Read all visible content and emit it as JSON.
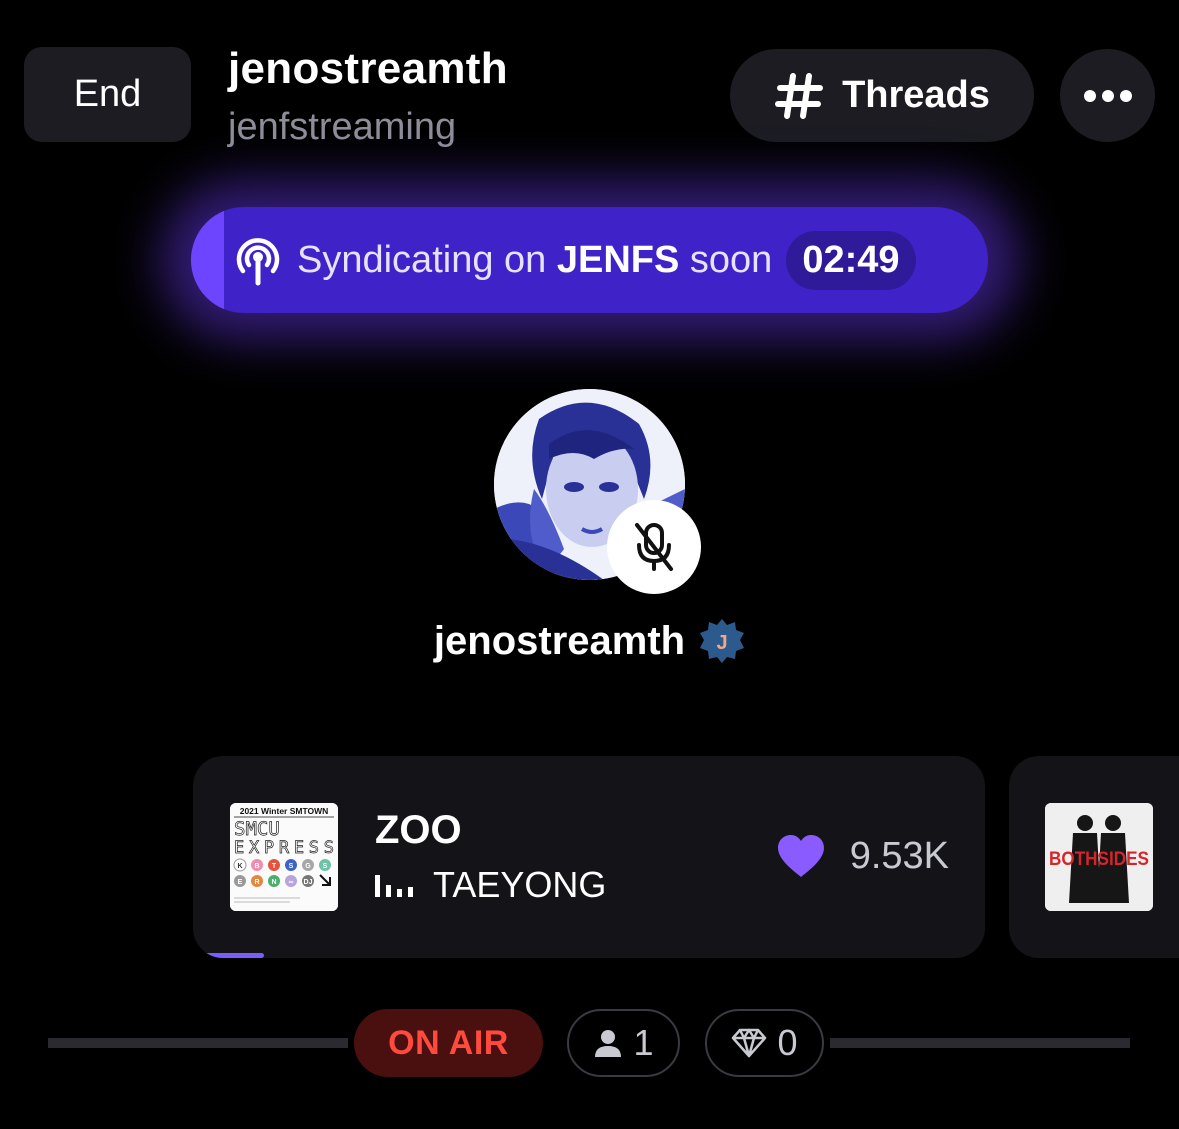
{
  "header": {
    "end_label": "End",
    "station_name": "jenostreamth",
    "station_handle": "jenfstreaming",
    "threads_label": "Threads",
    "threads_icon": "hash-icon",
    "more_icon": "more-dots-icon"
  },
  "syndication": {
    "prefix": "Syndicating on",
    "target": "JENFS",
    "suffix": "soon",
    "countdown": "02:49",
    "icon": "podcast-broadcast-icon",
    "color": "#3f22c8"
  },
  "host": {
    "name": "jenostreamth",
    "badge_letter": "J",
    "muted": true,
    "mute_icon": "mic-off-icon"
  },
  "now_playing": {
    "title": "ZOO",
    "artist": "TAEYONG",
    "likes": "9.53K",
    "heart_color": "#8a5cff",
    "progress": 0.09,
    "album_art": {
      "header": "2021 Winter SMTOWN",
      "line1": "SMCU",
      "line2": "EXPRESS",
      "row1": [
        "K",
        "B",
        "T",
        "S",
        "G",
        "S"
      ],
      "row2": [
        "E",
        "R",
        "N",
        "∞",
        "DJ"
      ]
    }
  },
  "up_next": {
    "album_text": "BOTHSIDES"
  },
  "footer": {
    "on_air_label": "ON AIR",
    "listeners": "1",
    "gems": "0"
  }
}
